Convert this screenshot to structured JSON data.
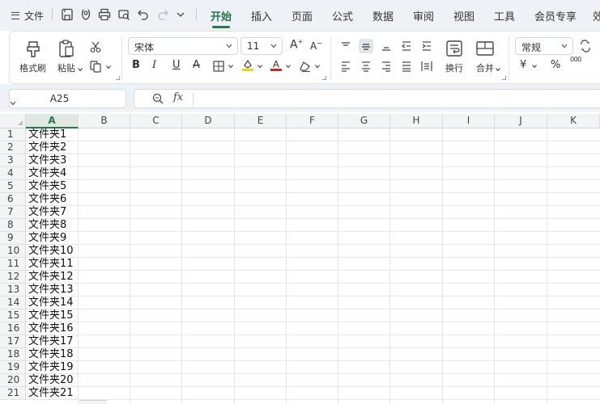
{
  "menubar": {
    "file_label": "文件",
    "tabs": [
      "开始",
      "插入",
      "页面",
      "公式",
      "数据",
      "审阅",
      "视图",
      "工具",
      "会员专享",
      "效"
    ],
    "active_tab_index": 0
  },
  "ribbon": {
    "format_painter": "格式刷",
    "paste": "粘贴",
    "font_name": "宋体",
    "font_size": "11",
    "wrap": "换行",
    "merge": "合并",
    "number_format": "常规",
    "currency_symbol": "¥",
    "percent_symbol": "%",
    "thousands_symbol": "000",
    "bold": "B",
    "italic": "I",
    "underline": "U",
    "strike": "A",
    "font_color_letter": "A",
    "grow_font": "A",
    "shrink_font": "A",
    "colors": {
      "highlight": "#f5d400",
      "font_color": "#e02020",
      "accent": "#1f7a4c"
    }
  },
  "formula_bar": {
    "name_box": "A25",
    "fx": "fx",
    "value": ""
  },
  "grid": {
    "columns": [
      "A",
      "B",
      "C",
      "D",
      "E",
      "F",
      "G",
      "H",
      "I",
      "J",
      "K"
    ],
    "selected_column": "A",
    "row_numbers": [
      "1",
      "2",
      "3",
      "4",
      "5",
      "6",
      "7",
      "8",
      "9",
      "10",
      "11",
      "12",
      "13",
      "14",
      "15",
      "16",
      "17",
      "18",
      "19",
      "20",
      "21"
    ],
    "col_a_values": [
      "文件夹1",
      "文件夹2",
      "文件夹3",
      "文件夹4",
      "文件夹5",
      "文件夹6",
      "文件夹7",
      "文件夹8",
      "文件夹9",
      "文件夹10",
      "文件夹11",
      "文件夹12",
      "文件夹13",
      "文件夹14",
      "文件夹15",
      "文件夹16",
      "文件夹17",
      "文件夹18",
      "文件夹19",
      "文件夹20",
      "文件夹21"
    ]
  }
}
